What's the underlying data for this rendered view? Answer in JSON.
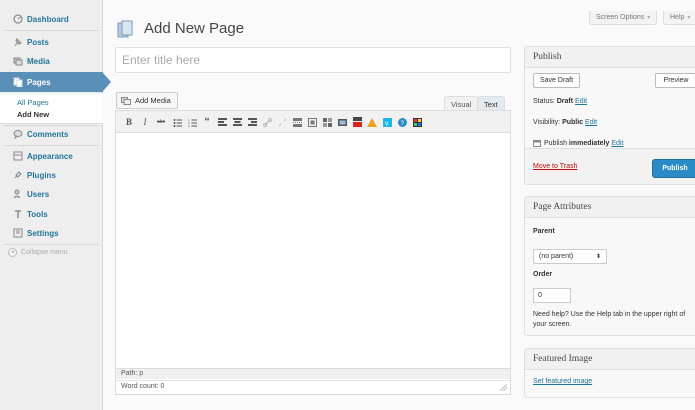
{
  "sidebar": {
    "items": [
      {
        "label": "Dashboard",
        "icon": "dashboard-icon"
      },
      {
        "label": "Posts",
        "icon": "pin-icon"
      },
      {
        "label": "Media",
        "icon": "media-icon"
      },
      {
        "label": "Pages",
        "icon": "pages-icon"
      },
      {
        "label": "Comments",
        "icon": "comment-icon"
      },
      {
        "label": "Appearance",
        "icon": "appearance-icon"
      },
      {
        "label": "Plugins",
        "icon": "plugin-icon"
      },
      {
        "label": "Users",
        "icon": "users-icon"
      },
      {
        "label": "Tools",
        "icon": "tools-icon"
      },
      {
        "label": "Settings",
        "icon": "settings-icon"
      }
    ],
    "submenu": [
      {
        "label": "All Pages"
      },
      {
        "label": "Add New"
      }
    ],
    "collapse_label": "Collapse menu"
  },
  "header": {
    "title": "Add New Page",
    "screen_options": "Screen Options",
    "help": "Help"
  },
  "title_field": {
    "placeholder": "Enter title here",
    "value": ""
  },
  "editor": {
    "add_media": "Add Media",
    "tab_visual": "Visual",
    "tab_text": "Text",
    "toolbar": {
      "bold": "B",
      "italic": "I",
      "strike": "abc",
      "blockquote": "“"
    },
    "path": "Path: p",
    "word_count": "Word count: 0"
  },
  "publish_box": {
    "title": "Publish",
    "save_draft": "Save Draft",
    "preview": "Preview",
    "status_label": "Status:",
    "status_value": "Draft",
    "visibility_label": "Visibility:",
    "visibility_value": "Public",
    "publish_label": "Publish",
    "publish_value": "immediately",
    "edit": "Edit",
    "move_to_trash": "Move to Trash",
    "publish_button": "Publish"
  },
  "page_attributes": {
    "title": "Page Attributes",
    "parent_label": "Parent",
    "parent_value": "(no parent)",
    "order_label": "Order",
    "order_value": "0",
    "help_text": "Need help? Use the Help tab in the upper right of your screen."
  },
  "featured_image": {
    "title": "Featured Image",
    "link": "Set featured image"
  },
  "colors": {
    "link": "#21759b",
    "current_menu": "#5a8fb8",
    "publish_button": "#2a8bc7",
    "trash": "#bc0b0b"
  }
}
